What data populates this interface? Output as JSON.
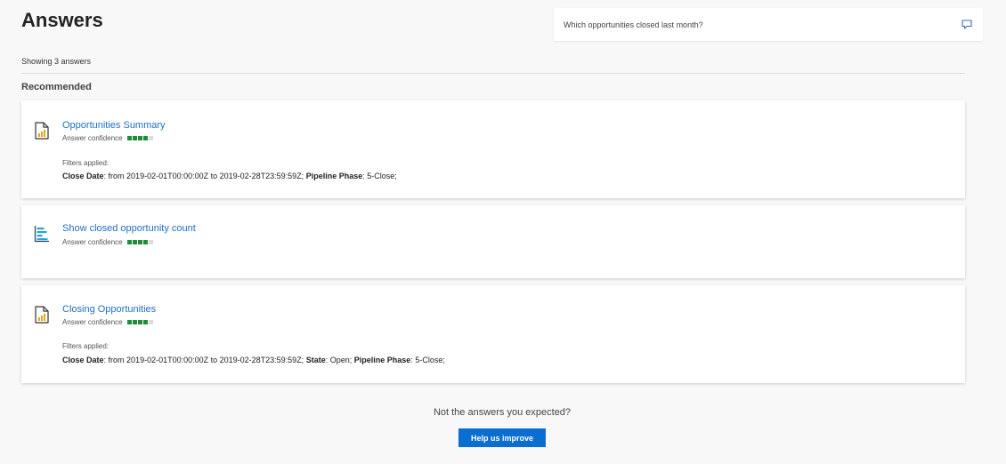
{
  "header": {
    "title": "Answers",
    "search_query": "Which opportunities closed last month?",
    "chat_icon": "chat-bubble-icon"
  },
  "summary": {
    "showing": "Showing 3 answers",
    "section": "Recommended"
  },
  "answers": [
    {
      "icon": "report-document-icon",
      "title": "Opportunities Summary",
      "confidence_label": "Answer confidence",
      "confidence_level": 4,
      "confidence_max": 5,
      "filters_label": "Filters applied:",
      "filters": [
        {
          "key": "Close Date",
          "value": "from 2019-02-01T00:00:00Z to 2019-02-28T23:59:59Z;"
        },
        {
          "key": "Pipeline Phase",
          "value": "5-Close;"
        }
      ]
    },
    {
      "icon": "bar-chart-icon",
      "title": "Show closed opportunity count",
      "confidence_label": "Answer confidence",
      "confidence_level": 4,
      "confidence_max": 5
    },
    {
      "icon": "report-document-icon",
      "title": "Closing Opportunities",
      "confidence_label": "Answer confidence",
      "confidence_level": 4,
      "confidence_max": 5,
      "filters_label": "Filters applied:",
      "filters": [
        {
          "key": "Close Date",
          "value": "from 2019-02-01T00:00:00Z to 2019-02-28T23:59:59Z;"
        },
        {
          "key": "State",
          "value": "Open;"
        },
        {
          "key": "Pipeline Phase",
          "value": "5-Close;"
        }
      ]
    }
  ],
  "footer": {
    "prompt": "Not the answers you expected?",
    "button": "Help us improve"
  },
  "colors": {
    "link": "#1f6fc5",
    "confidence_on": "#1f8c3b",
    "confidence_off": "#dcdcdc",
    "button": "#0a6ed1",
    "background": "#f8f8f8"
  }
}
